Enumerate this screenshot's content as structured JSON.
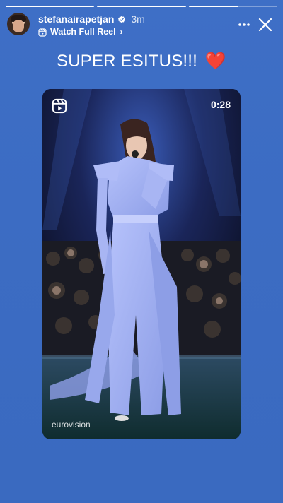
{
  "story": {
    "progress": [
      1.0,
      1.0,
      0.55
    ]
  },
  "header": {
    "username": "stefanairapetjan",
    "verified": true,
    "time": "3m",
    "reel_link": "Watch Full Reel",
    "more_icon": "more-horizontal-icon",
    "close_icon": "close-icon"
  },
  "caption": {
    "text": "SUPER ESITUS!!!",
    "emoji": "❤️"
  },
  "reel": {
    "duration": "0:28",
    "watermark": "eurovision",
    "icon": "reels-icon"
  },
  "colors": {
    "background": "#3c6cc3",
    "outfit": "#a4b3f3",
    "heart": "#ff3040"
  }
}
